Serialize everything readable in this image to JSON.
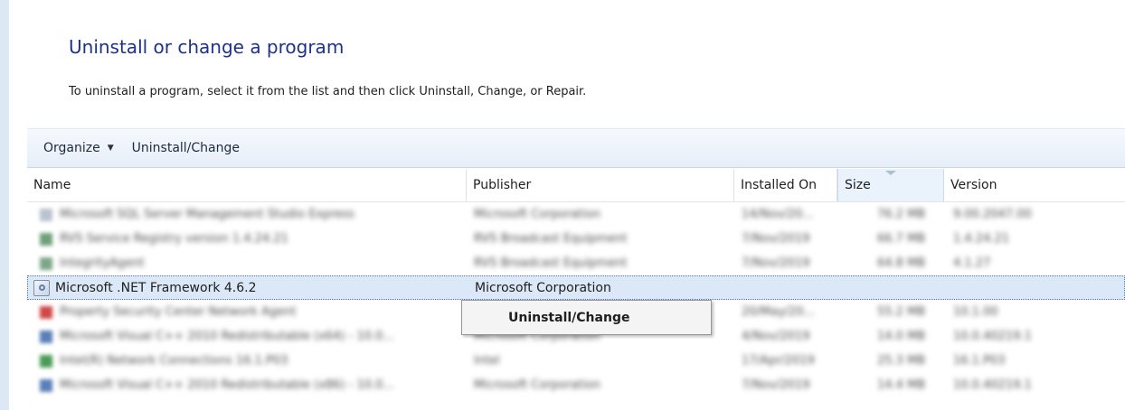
{
  "page": {
    "title": "Uninstall or change a program",
    "description": "To uninstall a program, select it from the list and then click Uninstall, Change, or Repair."
  },
  "toolbar": {
    "organize_label": "Organize",
    "uninstall_change_label": "Uninstall/Change"
  },
  "columns": {
    "name": "Name",
    "publisher": "Publisher",
    "installed_on": "Installed On",
    "size": "Size",
    "version": "Version"
  },
  "rows": [
    {
      "name": "Microsoft SQL Server Management Studio Express",
      "publisher": "Microsoft Corporation",
      "installed_on": "14/Nov/20...",
      "size": "76.2 MB",
      "version": "9.00.2047.00",
      "icon_color": "#b9c2cf"
    },
    {
      "name": "RVS Service Registry version 1.4.24.21",
      "publisher": "RVS Broadcast Equipment",
      "installed_on": "7/Nov/2019",
      "size": "66.7 MB",
      "version": "1.4.24.21",
      "icon_color": "#6fa07a"
    },
    {
      "name": "IntegrityAgent",
      "publisher": "RVS Broadcast Equipment",
      "installed_on": "7/Nov/2019",
      "size": "64.8 MB",
      "version": "4.1.27",
      "icon_color": "#7ea58a"
    },
    {
      "name": "Microsoft .NET Framework 4.6.2",
      "publisher": "Microsoft Corporation",
      "installed_on": "",
      "size": "",
      "version": "",
      "icon_color": "#8da3c2",
      "selected": true
    },
    {
      "name": "Property Security Center Network Agent",
      "publisher": "",
      "installed_on": "20/May/20...",
      "size": "55.2 MB",
      "version": "10.1.00",
      "icon_color": "#d04848"
    },
    {
      "name": "Microsoft Visual C++ 2010 Redistributable (x64) - 10.0...",
      "publisher": "Microsoft Corporation",
      "installed_on": "4/Nov/2019",
      "size": "14.0 MB",
      "version": "10.0.40219.1",
      "icon_color": "#5a7fb8"
    },
    {
      "name": "Intel(R) Network Connections 16.1.P03",
      "publisher": "Intel",
      "installed_on": "17/Apr/2019",
      "size": "25.3 MB",
      "version": "16.1.P03",
      "icon_color": "#4c9a57"
    },
    {
      "name": "Microsoft Visual C++ 2010 Redistributable (x86) - 10.0...",
      "publisher": "Microsoft Corporation",
      "installed_on": "7/Nov/2019",
      "size": "14.4 MB",
      "version": "10.0.40219.1",
      "icon_color": "#5a7fb8"
    }
  ],
  "context_menu": {
    "item_label": "Uninstall/Change"
  },
  "icons": {
    "organize_dropdown": "chevron-down-icon",
    "program": "app-icon",
    "net_framework": "dotnet-installer-icon"
  }
}
